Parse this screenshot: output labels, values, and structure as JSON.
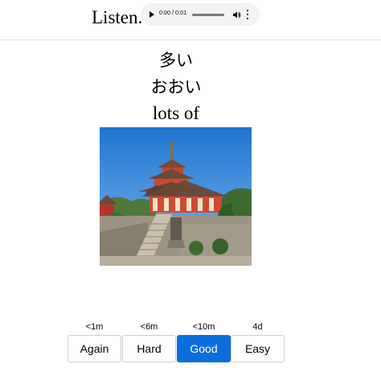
{
  "header": {
    "title": "Listen."
  },
  "audio_player": {
    "time_display": "0:00 / 0:01",
    "play_icon": "play-icon",
    "volume_icon": "speaker-icon",
    "menu_icon": "more-vertical-icon"
  },
  "card": {
    "kanji": "多い",
    "kana": "おおい",
    "meaning": "lots of",
    "image": "kiyomizu-pagoda-photo"
  },
  "answer_buttons": [
    {
      "interval": "<1m",
      "label": "Again"
    },
    {
      "interval": "<6m",
      "label": "Hard"
    },
    {
      "interval": "<10m",
      "label": "Good"
    },
    {
      "interval": "4d",
      "label": "Easy"
    }
  ],
  "colors": {
    "accent": "#0b6ede",
    "divider": "#e2e2e2",
    "player_bg": "#f1f3f4"
  }
}
